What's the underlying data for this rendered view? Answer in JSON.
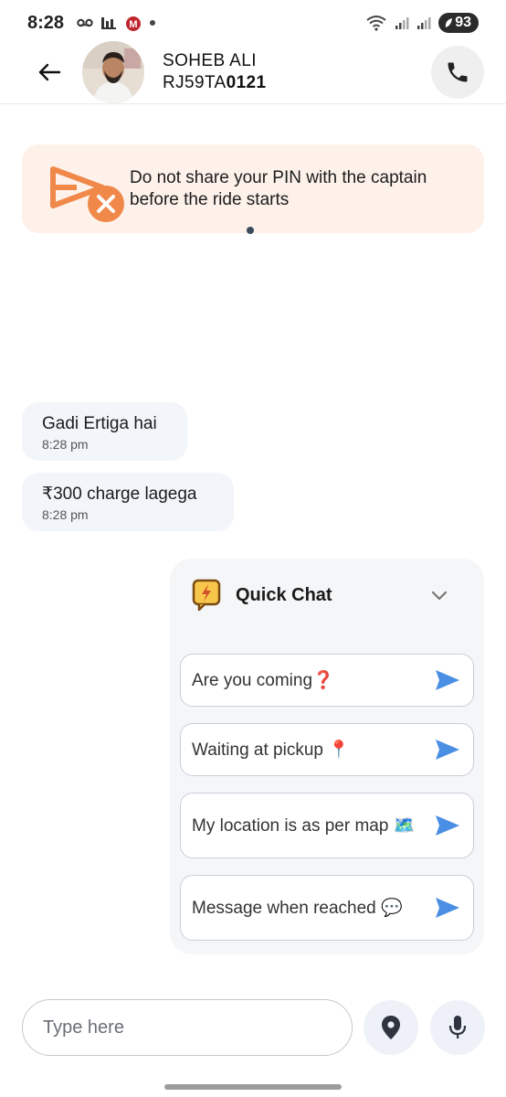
{
  "status_bar": {
    "time": "8:28",
    "battery": "93"
  },
  "header": {
    "driver_name": "SOHEB ALI",
    "plate_prefix": "RJ59TA",
    "plate_suffix": "0121"
  },
  "banner": {
    "text": "Do not share your PIN with the captain before the ride starts",
    "accent_color": "#f0884a"
  },
  "messages": [
    {
      "text": "Gadi Ertiga hai",
      "time": "8:28 pm"
    },
    {
      "text": "₹300 charge lagega",
      "time": "8:28 pm"
    }
  ],
  "quick_chat": {
    "title": "Quick Chat",
    "items": [
      {
        "label": "Are you coming❓"
      },
      {
        "label": "Waiting at pickup 📍"
      },
      {
        "label": "My location is as per map 🗺️"
      },
      {
        "label": "Message when reached 💬"
      }
    ],
    "send_color": "#4a8fe3"
  },
  "composer": {
    "placeholder": "Type here"
  },
  "icons": {
    "back": "arrow-left-icon",
    "call": "phone-icon",
    "safety": "pin-warning-icon",
    "quick_chat": "lightning-chat-icon",
    "collapse": "chevron-down-icon",
    "send": "send-icon",
    "location": "location-pin-icon",
    "mic": "microphone-icon"
  }
}
